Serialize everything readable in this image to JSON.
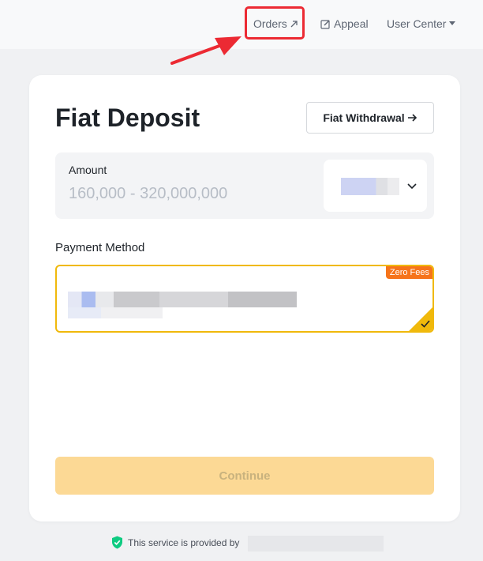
{
  "header": {
    "orders_label": "Orders",
    "appeal_label": "Appeal",
    "user_center_label": "User Center"
  },
  "deposit": {
    "title": "Fiat Deposit",
    "withdraw_button": "Fiat Withdrawal",
    "amount_label": "Amount",
    "amount_placeholder": "160,000 - 320,000,000",
    "payment_method_label": "Payment Method",
    "zero_fees_badge": "Zero Fees",
    "continue_button": "Continue"
  },
  "footer": {
    "service_text": "This service is provided by"
  },
  "colors": {
    "accent": "#f0b90b",
    "badge": "#f6741a",
    "highlight": "#ec2a33",
    "verified": "#0ecb81"
  },
  "icons": [
    "external-link-icon",
    "edit-icon",
    "caret-down-icon",
    "arrow-right-icon",
    "chevron-down-icon",
    "check-icon",
    "shield-check-icon"
  ]
}
